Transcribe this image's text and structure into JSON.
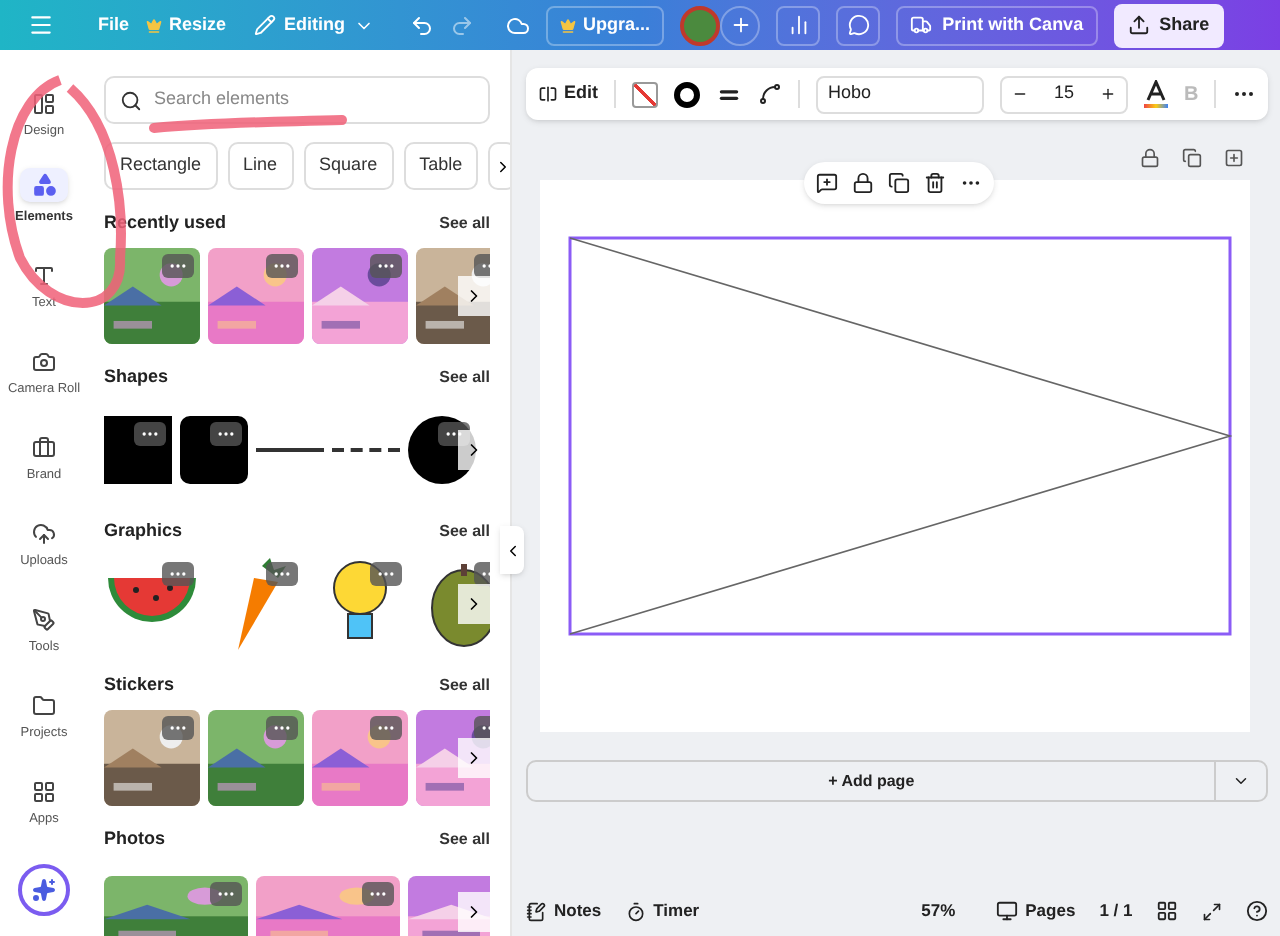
{
  "topbar": {
    "file": "File",
    "resize": "Resize",
    "mode": "Editing",
    "upgrade": "Upgra...",
    "print": "Print with Canva",
    "share": "Share"
  },
  "rail": [
    {
      "label": "Design",
      "selected": false
    },
    {
      "label": "Elements",
      "selected": true
    },
    {
      "label": "Text",
      "selected": false
    },
    {
      "label": "Camera Roll",
      "selected": false
    },
    {
      "label": "Brand",
      "selected": false
    },
    {
      "label": "Uploads",
      "selected": false
    },
    {
      "label": "Tools",
      "selected": false
    },
    {
      "label": "Projects",
      "selected": false
    },
    {
      "label": "Apps",
      "selected": false
    }
  ],
  "panel": {
    "search": {
      "placeholder": "Search elements"
    },
    "chips": [
      "Rectangle",
      "Line",
      "Square",
      "Table"
    ],
    "sections": [
      {
        "title": "Recently used",
        "link": "See all"
      },
      {
        "title": "Shapes",
        "link": "See all",
        "items": [
          {
            "kind": "square"
          },
          {
            "kind": "rounded"
          },
          {
            "kind": "line"
          },
          {
            "kind": "dashed"
          },
          {
            "kind": "circle"
          }
        ]
      },
      {
        "title": "Graphics",
        "link": "See all",
        "items": [
          {
            "kind": "watermelon"
          },
          {
            "kind": "carrot"
          },
          {
            "kind": "bulb"
          },
          {
            "kind": "melon"
          }
        ]
      },
      {
        "title": "Stickers",
        "link": "See all"
      },
      {
        "title": "Photos",
        "link": "See all"
      }
    ]
  },
  "toolbar": {
    "edit": "Edit",
    "font": "Hobo",
    "size": "15",
    "bold": {
      "label": "B",
      "disabled": true
    }
  },
  "canvas": {
    "add_page": "+ Add page"
  },
  "footer": {
    "notes": "Notes",
    "timer": "Timer",
    "zoom": "57%",
    "pages": "Pages",
    "page_count": "1 / 1"
  }
}
